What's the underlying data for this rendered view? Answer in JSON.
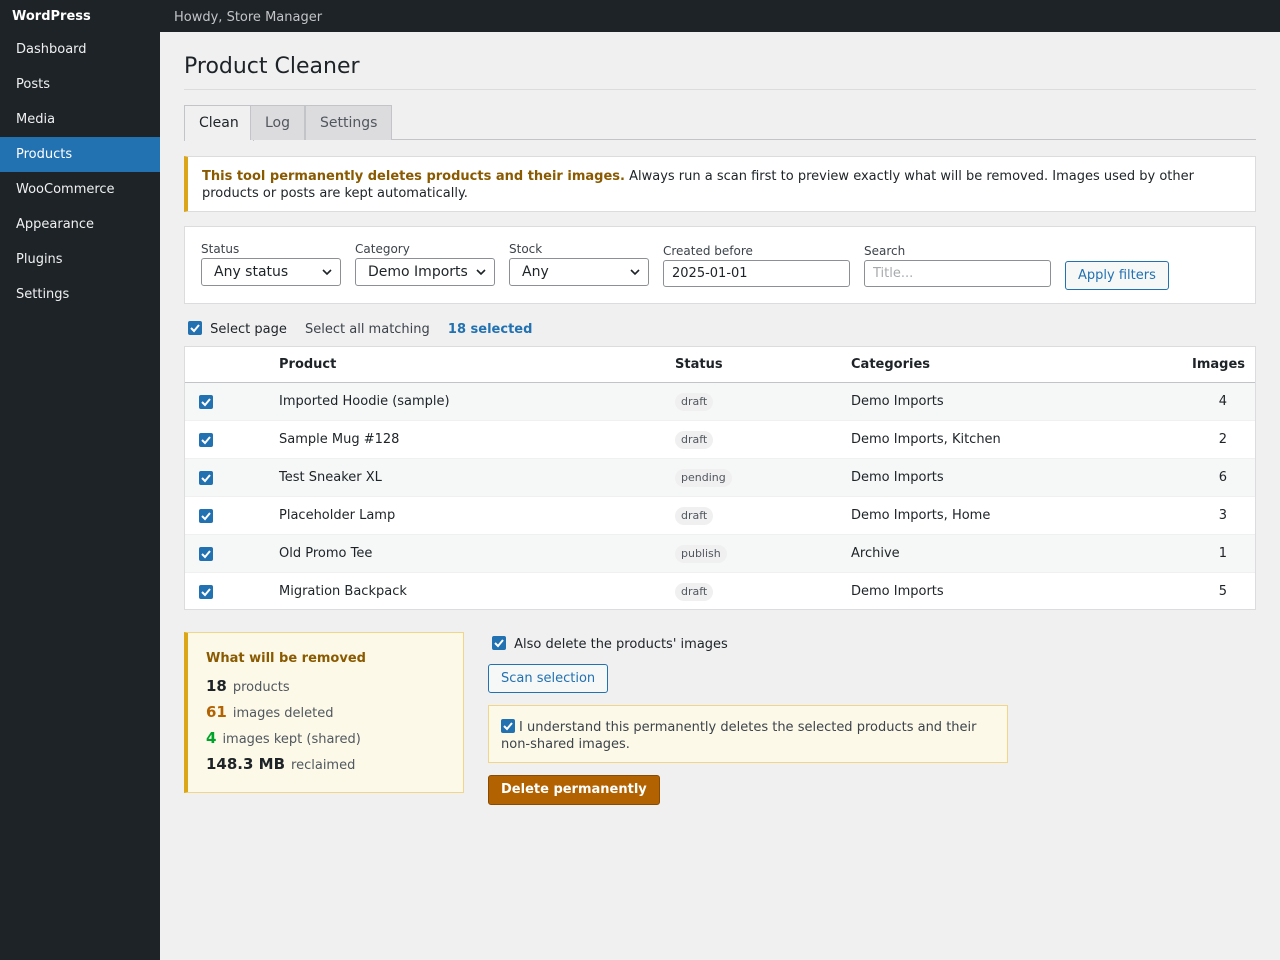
{
  "sidebar": {
    "brand": "WordPress",
    "items": [
      {
        "label": "Dashboard"
      },
      {
        "label": "Posts"
      },
      {
        "label": "Media"
      },
      {
        "label": "Products",
        "active": true
      },
      {
        "label": "WooCommerce"
      },
      {
        "label": "Appearance"
      },
      {
        "label": "Plugins"
      },
      {
        "label": "Settings"
      }
    ]
  },
  "adminbar": {
    "greeting": "Howdy, Store Manager"
  },
  "page": {
    "title": "Product Cleaner"
  },
  "tabs": [
    {
      "label": "Clean",
      "active": true
    },
    {
      "label": "Log"
    },
    {
      "label": "Settings"
    }
  ],
  "notice": {
    "strong": "This tool permanently deletes products and their images.",
    "text": " Always run a scan first to preview exactly what will be removed. Images used by other products or posts are kept automatically."
  },
  "filters": {
    "status_label": "Status",
    "status_value": "Any status",
    "category_label": "Category",
    "category_value": "Demo Imports",
    "stock_label": "Stock",
    "stock_value": "Any",
    "created_label": "Created before",
    "created_value": "2025-01-01",
    "search_label": "Search",
    "search_placeholder": "Title...",
    "apply_label": "Apply filters"
  },
  "selection": {
    "select_page": "Select page",
    "select_all": "Select all matching",
    "selected_count": "18 selected"
  },
  "table": {
    "headers": {
      "product": "Product",
      "status": "Status",
      "categories": "Categories",
      "images": "Images"
    },
    "rows": [
      {
        "product": "Imported Hoodie (sample)",
        "status": "draft",
        "categories": "Demo Imports",
        "images": "4"
      },
      {
        "product": "Sample Mug #128",
        "status": "draft",
        "categories": "Demo Imports, Kitchen",
        "images": "2"
      },
      {
        "product": "Test Sneaker XL",
        "status": "pending",
        "categories": "Demo Imports",
        "images": "6"
      },
      {
        "product": "Placeholder Lamp",
        "status": "draft",
        "categories": "Demo Imports, Home",
        "images": "3"
      },
      {
        "product": "Old Promo Tee",
        "status": "publish",
        "categories": "Archive",
        "images": "1"
      },
      {
        "product": "Migration Backpack",
        "status": "draft",
        "categories": "Demo Imports",
        "images": "5"
      }
    ]
  },
  "summary": {
    "title": "What will be removed",
    "products_num": "18",
    "products_label": "products",
    "images_num": "61",
    "images_label": "images deleted",
    "kept_num": "4",
    "kept_label": "images kept (shared)",
    "size_num": "148.3 MB",
    "size_label": "reclaimed"
  },
  "actions": {
    "also_delete_images": "Also delete the products' images",
    "scan_label": "Scan selection",
    "confirm_text": "I understand this permanently deletes the selected products and their non-shared images.",
    "delete_label": "Delete permanently"
  },
  "colors": {
    "accent": "#2271b1",
    "warning": "#dba617",
    "danger_button": "#b26200",
    "sidebar_bg": "#1d2327",
    "images_num": "#b26200",
    "kept_num": "#00a32a"
  },
  "icons": {
    "checkbox": "checkmark-icon",
    "select": "chevron-down-icon"
  }
}
